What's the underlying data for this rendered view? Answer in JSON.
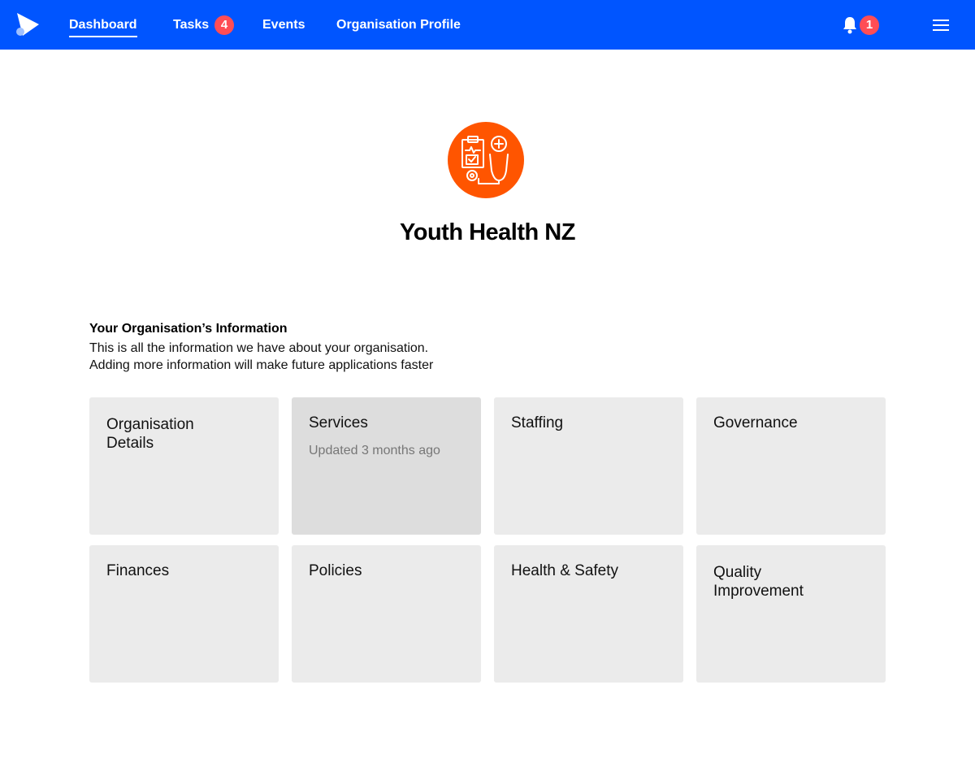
{
  "nav": {
    "links": [
      {
        "label": "Dashboard"
      },
      {
        "label": "Tasks",
        "badge": "4"
      },
      {
        "label": "Events"
      },
      {
        "label": "Organisation Profile"
      }
    ],
    "notifications_badge": "1",
    "icons": {
      "logo": "play-logo-icon",
      "bell": "bell-icon",
      "menu": "hamburger-menu-icon"
    },
    "colors": {
      "nav_bg": "#0055ff",
      "badge": "#ff4d55",
      "org_logo": "#ff5500"
    }
  },
  "organisation": {
    "name": "Youth Health NZ",
    "logo_icon": "medical-checklist-stethoscope-icon"
  },
  "info": {
    "title": "Your Organisation’s Information",
    "line1": "This is all the information we have about your organisation.",
    "line2": "Adding more information will make future applications faster"
  },
  "cards": [
    {
      "title": "Organisation Details",
      "subtitle": ""
    },
    {
      "title": "Services",
      "subtitle": "Updated 3 months ago"
    },
    {
      "title": "Staffing",
      "subtitle": ""
    },
    {
      "title": "Governance",
      "subtitle": ""
    },
    {
      "title": "Finances",
      "subtitle": ""
    },
    {
      "title": "Policies",
      "subtitle": ""
    },
    {
      "title": "Health & Safety",
      "subtitle": ""
    },
    {
      "title": "Quality Improvement",
      "subtitle": ""
    }
  ]
}
